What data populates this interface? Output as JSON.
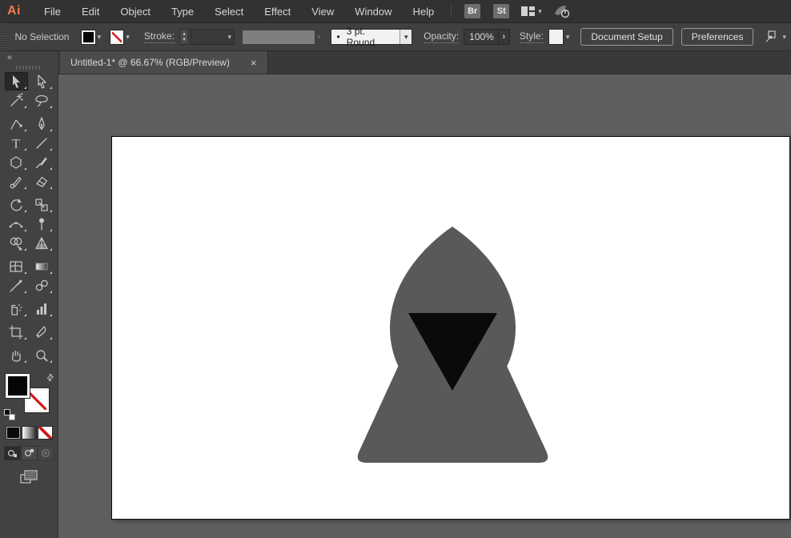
{
  "app": {
    "logo_text": "Ai"
  },
  "menu_bar": {
    "items": [
      "File",
      "Edit",
      "Object",
      "Type",
      "Select",
      "Effect",
      "View",
      "Window",
      "Help"
    ],
    "bridge_button": "Br",
    "stock_button": "St"
  },
  "control_bar": {
    "selection_status": "No Selection",
    "stroke_label": "Stroke:",
    "stepper_up": "▴",
    "stepper_down": "▾",
    "brush_bullet": "•",
    "brush_value": "3 pt. Round",
    "opacity_label": "Opacity:",
    "opacity_value": "100%",
    "opacity_arrow": "›",
    "style_label": "Style:",
    "document_setup_button": "Document Setup",
    "preferences_button": "Preferences",
    "dropdown_glyph": "▾"
  },
  "tab_bar": {
    "active_tab": {
      "title": "Untitled-1* @ 66.67% (RGB/Preview)",
      "close_glyph": "×"
    }
  },
  "toolbar": {
    "collapse_glyph": "«",
    "active_tool": "selection",
    "swap_glyph": "⇄",
    "type_tool_letter": "T",
    "tools": [
      "selection",
      "direct-selection",
      "magic-wand",
      "lasso",
      "curvature",
      "pen",
      "type",
      "line-segment",
      "shape",
      "paintbrush",
      "shaper",
      "eraser",
      "rotate",
      "scale",
      "width",
      "puppet-warp",
      "shape-builder",
      "perspective-grid",
      "mesh",
      "gradient",
      "eyedropper",
      "blend",
      "symbol-sprayer",
      "column-graph",
      "artboard",
      "slice",
      "hand",
      "zoom"
    ]
  },
  "colors": {
    "chrome_dark": "#323232",
    "chrome_mid": "#404040",
    "panel": "#424242",
    "pasteboard": "#5f5f5f",
    "accent_logo": "#e87b4a",
    "none_slash_red": "#cf1d1d",
    "artboard_white": "#ffffff"
  },
  "artwork": {
    "figure": "hooded-person",
    "hood_color": "#59595b",
    "body_color": "#59595b",
    "face_color": "#0a0a0a"
  }
}
